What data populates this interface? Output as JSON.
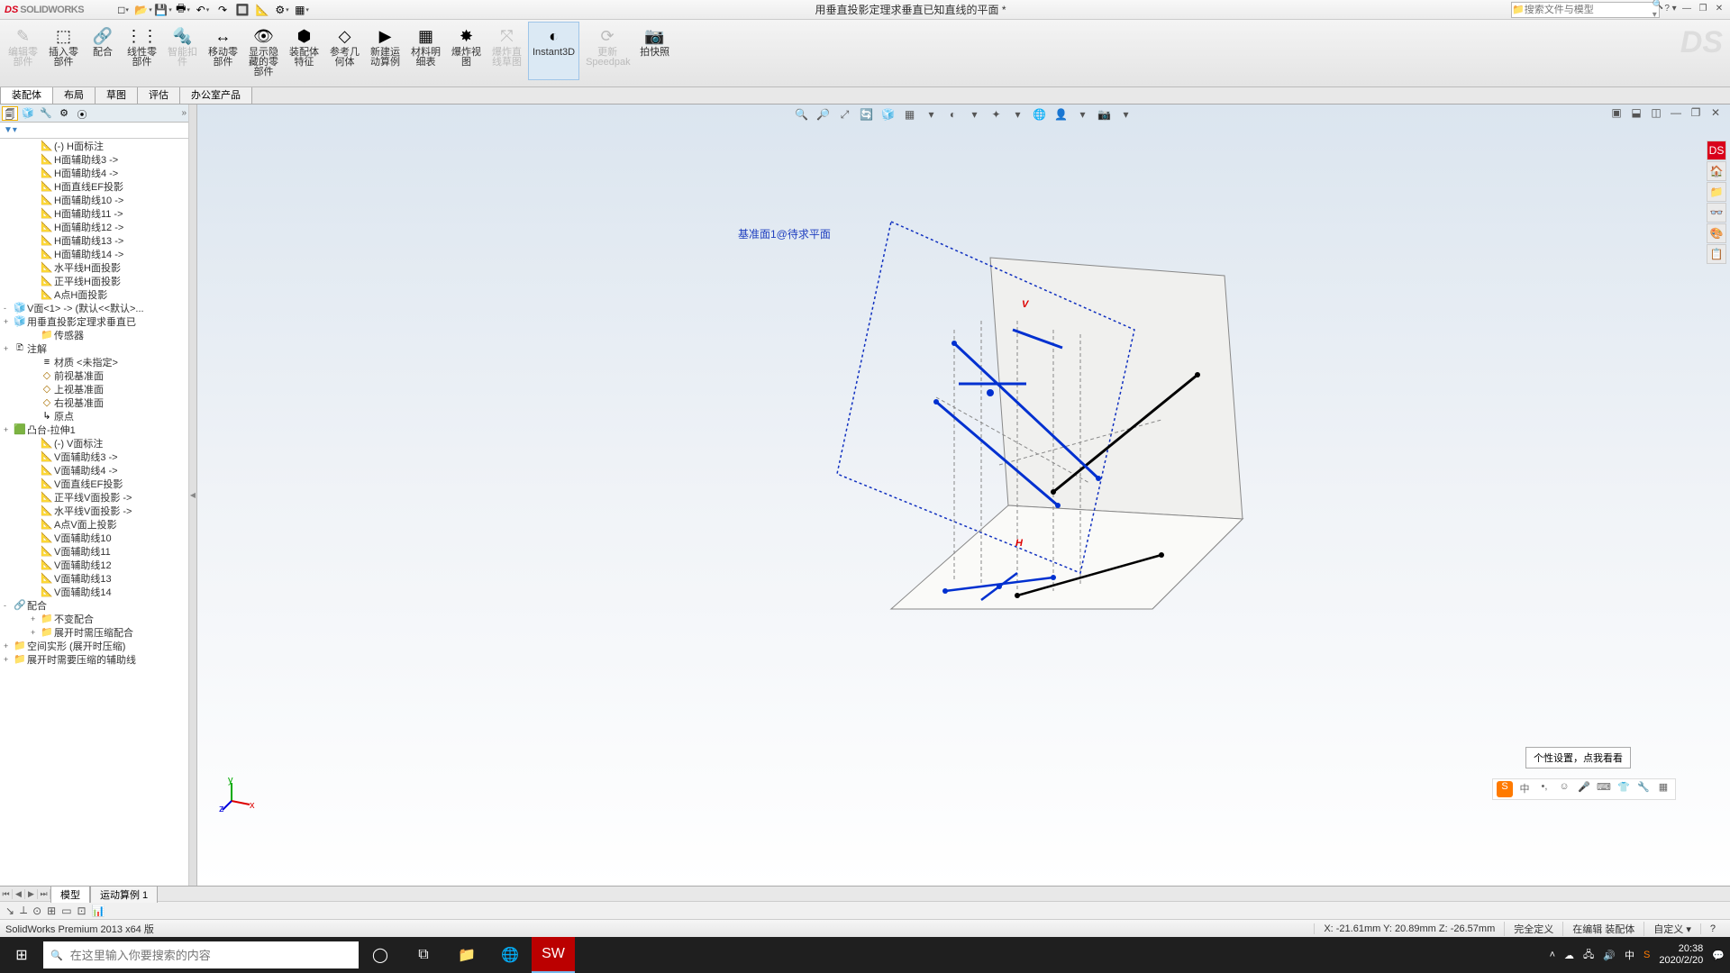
{
  "title": "用垂直投影定理求垂直已知直线的平面 *",
  "logo": {
    "ds": "DS",
    "text": "SOLIDWORKS"
  },
  "search_placeholder": "搜索文件与模型",
  "qat": [
    "□",
    "📂",
    "💾",
    "🖶",
    "↶",
    "↷",
    "🔲",
    "📐",
    "⚙",
    "▦"
  ],
  "ribbon": [
    {
      "id": "edit-component",
      "label": "编辑零\n部件",
      "icon": "✎",
      "dis": true
    },
    {
      "id": "insert-component",
      "label": "插入零\n部件",
      "icon": "⬚"
    },
    {
      "id": "mate",
      "label": "配合",
      "icon": "🔗"
    },
    {
      "id": "linear-pattern",
      "label": "线性零\n部件",
      "icon": "⋮⋮"
    },
    {
      "id": "smart-fastener",
      "label": "智能扣\n件",
      "icon": "🔩",
      "dis": true
    },
    {
      "id": "move-component",
      "label": "移动零\n部件",
      "icon": "↔"
    },
    {
      "id": "show-hidden",
      "label": "显示隐\n藏的零\n部件",
      "icon": "👁"
    },
    {
      "id": "assembly-feature",
      "label": "装配体\n特征",
      "icon": "⬢"
    },
    {
      "id": "ref-geometry",
      "label": "参考几\n何体",
      "icon": "◇"
    },
    {
      "id": "new-motion",
      "label": "新建运\n动算例",
      "icon": "▶"
    },
    {
      "id": "bom",
      "label": "材料明\n细表",
      "icon": "▦"
    },
    {
      "id": "exploded-view",
      "label": "爆炸视\n图",
      "icon": "✸"
    },
    {
      "id": "explode-line",
      "label": "爆炸直\n线草图",
      "icon": "⤧",
      "dis": true
    },
    {
      "id": "instant3d",
      "label": "Instant3D",
      "icon": "◐",
      "active": true
    },
    {
      "id": "speedpak",
      "label": "更新\nSpeedpak",
      "icon": "⟳",
      "dis": true
    },
    {
      "id": "snapshot",
      "label": "拍快照",
      "icon": "📷"
    }
  ],
  "cm_tabs": [
    "装配体",
    "布局",
    "草图",
    "评估",
    "办公室产品"
  ],
  "cm_active": 0,
  "fm_tabs": [
    "🗐",
    "🧊",
    "🔧",
    "⚙",
    "⦿"
  ],
  "tree": [
    {
      "l": 1,
      "i": "sketch",
      "t": "(-) H面标注"
    },
    {
      "l": 1,
      "i": "sketch",
      "t": "H面辅助线3 ->"
    },
    {
      "l": 1,
      "i": "sketch",
      "t": "H面辅助线4 ->"
    },
    {
      "l": 1,
      "i": "sketch",
      "t": "H面直线EF投影"
    },
    {
      "l": 1,
      "i": "sketch",
      "t": "H面辅助线10 ->"
    },
    {
      "l": 1,
      "i": "sketch",
      "t": "H面辅助线11 ->"
    },
    {
      "l": 1,
      "i": "sketch",
      "t": "H面辅助线12 ->"
    },
    {
      "l": 1,
      "i": "sketch",
      "t": "H面辅助线13 ->"
    },
    {
      "l": 1,
      "i": "sketch",
      "t": "H面辅助线14 ->"
    },
    {
      "l": 1,
      "i": "sketch",
      "t": "水平线H面投影"
    },
    {
      "l": 1,
      "i": "sketch",
      "t": "正平线H面投影"
    },
    {
      "l": 1,
      "i": "sketch",
      "t": "A点H面投影"
    },
    {
      "l": 0,
      "e": "-",
      "i": "asm",
      "t": "V面<1> -> (默认<<默认>..."
    },
    {
      "l": 0,
      "e": "+",
      "i": "asm",
      "t": "用垂直投影定理求垂直已"
    },
    {
      "l": 1,
      "i": "folder",
      "t": "传感器"
    },
    {
      "l": 0,
      "e": "+",
      "i": "note",
      "t": "注解"
    },
    {
      "l": 1,
      "i": "mat",
      "t": "材质 <未指定>"
    },
    {
      "l": 1,
      "i": "plane",
      "t": "前视基准面"
    },
    {
      "l": 1,
      "i": "plane",
      "t": "上视基准面"
    },
    {
      "l": 1,
      "i": "plane",
      "t": "右视基准面"
    },
    {
      "l": 1,
      "i": "origin",
      "t": "原点"
    },
    {
      "l": 0,
      "e": "+",
      "i": "feat",
      "t": "凸台-拉伸1"
    },
    {
      "l": 1,
      "i": "sketch",
      "t": "(-) V面标注"
    },
    {
      "l": 1,
      "i": "sketch",
      "t": "V面辅助线3 ->"
    },
    {
      "l": 1,
      "i": "sketch",
      "t": "V面辅助线4 ->"
    },
    {
      "l": 1,
      "i": "sketch",
      "t": "V面直线EF投影"
    },
    {
      "l": 1,
      "i": "sketch",
      "t": "正平线V面投影 ->"
    },
    {
      "l": 1,
      "i": "sketch",
      "t": "水平线V面投影 ->"
    },
    {
      "l": 1,
      "i": "sketch",
      "t": "A点V面上投影"
    },
    {
      "l": 1,
      "i": "sketch",
      "t": "V面辅助线10"
    },
    {
      "l": 1,
      "i": "sketch",
      "t": "V面辅助线11"
    },
    {
      "l": 1,
      "i": "sketch",
      "t": "V面辅助线12"
    },
    {
      "l": 1,
      "i": "sketch",
      "t": "V面辅助线13"
    },
    {
      "l": 1,
      "i": "sketch",
      "t": "V面辅助线14"
    },
    {
      "l": 0,
      "e": "-",
      "i": "mate",
      "t": "配合"
    },
    {
      "l": 1,
      "e": "+",
      "i": "folder",
      "t": "不变配合"
    },
    {
      "l": 1,
      "e": "+",
      "i": "folder",
      "t": "展开时需压缩配合"
    },
    {
      "l": 0,
      "e": "+",
      "i": "folder",
      "t": "空间实形 (展开时压缩)"
    },
    {
      "l": 0,
      "e": "+",
      "i": "folder",
      "t": "展开时需要压缩的辅助线"
    }
  ],
  "viewtb": [
    "🔍",
    "🔎",
    "⤢",
    "🔄",
    "🧊",
    "▦",
    "▾",
    "◐",
    "▾",
    "✦",
    "▾",
    "🌐",
    "👤",
    "▾",
    "📷",
    "▾"
  ],
  "sketch_label": "基准面1@待求平面",
  "bottom_tabs": [
    "模型",
    "运动算例 1"
  ],
  "status": {
    "left": "SolidWorks Premium 2013 x64 版",
    "coords": "X: -21.61mm Y: 20.89mm Z: -26.57mm",
    "def": "完全定义",
    "mode": "在编辑 装配体",
    "custom": "自定义 ▾"
  },
  "tooltip": "个性设置，点我看看",
  "taskbar": {
    "search": "在这里输入你要搜索的内容",
    "time": "20:38",
    "date": "2020/2/20"
  }
}
